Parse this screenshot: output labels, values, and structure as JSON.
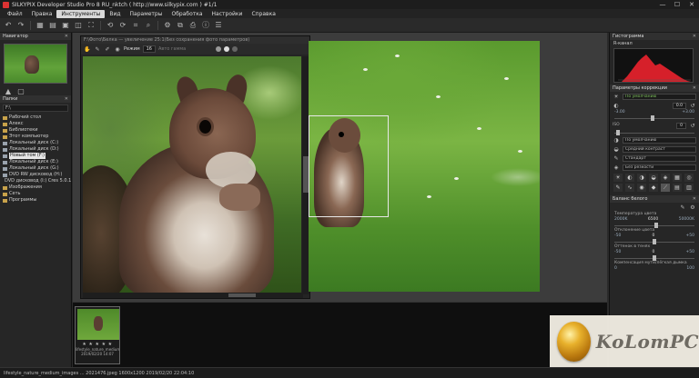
{
  "window": {
    "title": "SILKYPIX Developer Studio Pro 8 RU_nktch ( http://www.silkypix.com )  #1/1",
    "minimize": "—",
    "maximize": "☐",
    "close": "✕"
  },
  "menu": [
    "Файл",
    "Правка",
    "Инструменты",
    "Вид",
    "Параметры",
    "Обработка",
    "Настройки",
    "Справка"
  ],
  "menu_active_index": 2,
  "left_panel": {
    "navigator_header": "Навигатор",
    "folder_header": "Папки",
    "path_value": "F:\\",
    "tree": [
      {
        "label": "Рабочий стол",
        "type": "folder"
      },
      {
        "label": "Алекс",
        "type": "folder"
      },
      {
        "label": "Библиотеки",
        "type": "folder"
      },
      {
        "label": "Этот компьютер",
        "type": "folder"
      },
      {
        "label": "Локальный диск (C:)",
        "type": "drive"
      },
      {
        "label": "Локальный диск (D:)",
        "type": "drive"
      },
      {
        "label": "Новый том (F:)",
        "type": "drive",
        "selected": true
      },
      {
        "label": "Локальный диск (E:)",
        "type": "drive"
      },
      {
        "label": "Локальный диск (G:)",
        "type": "drive"
      },
      {
        "label": "DVD RW дисковод (H:)",
        "type": "drive"
      },
      {
        "label": "DVD дисковод (I:) Cres 5.0.1",
        "type": "drive"
      },
      {
        "label": "Изображения",
        "type": "folder"
      },
      {
        "label": "Сеть",
        "type": "folder"
      },
      {
        "label": "Программы",
        "type": "folder"
      }
    ]
  },
  "viewer": {
    "title": "F:\\Фото\\Белка — увеличение 25:1(Без сохранения фото параметров)",
    "tool_label": "Режим",
    "tool_value": "16",
    "tool_hint": "Авто гамма"
  },
  "filmstrip": {
    "stars": "★ ★ ★ ★ ★",
    "filename": "lifestyle_nature_medium_image",
    "meta": "2019/02/20 14:07"
  },
  "right_panel": {
    "histogram_header": "Гистограмма",
    "histogram_mode": "R-канал",
    "correction_header": "Параметры коррекции",
    "wb_preset": "По умолчанию",
    "exposure_value": "0.0",
    "exposure_min": "-3.00",
    "exposure_max": "+3.00",
    "iso_label": "ISO",
    "iso_value": "0",
    "tone_preset": "По умолчанию",
    "contrast_preset": "Средний контраст",
    "color_preset": "Стандарт",
    "sharpness_preset": "Без резкости",
    "wb_header": "Баланс белого",
    "temp_label": "Температура цвета",
    "temp_min": "2000K",
    "temp_value": "6500",
    "temp_max": "50000K",
    "tint_label": "Отклонение цвета",
    "tint_min": "-50",
    "tint_value": "0",
    "tint_max": "+50",
    "hue_label": "Оттенок в тенях",
    "hue_min": "-50",
    "hue_value": "0",
    "hue_max": "+50",
    "dark_label": "Компенсация мути/лёгкая дымка",
    "dark_min": "0",
    "dark_max": "100"
  },
  "watermark": {
    "text": "KoLomPC"
  },
  "statusbar": {
    "text": "lifestyle_nature_medium_images ... 2021476.jpeg  1600x1200   2019/02/20  22:04:10"
  },
  "colors": {
    "histogram_fill": "#d6202a",
    "accent_green": "#7cc05a"
  }
}
